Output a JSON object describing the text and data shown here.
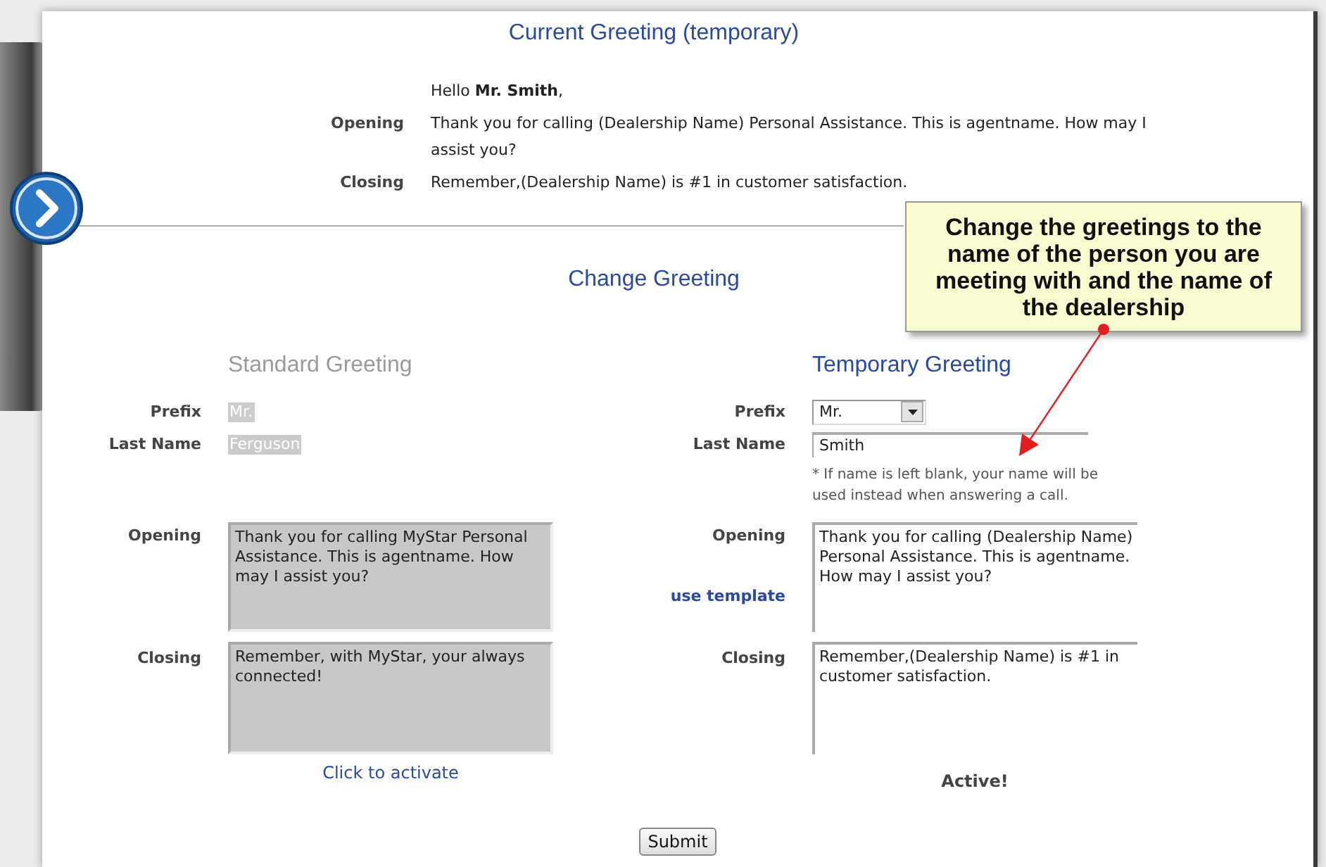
{
  "current_greeting": {
    "title": "Current Greeting (temporary)",
    "salutation": "Hello **Mr. Smith**,",
    "rows": [
      {
        "label": "Opening",
        "text": "Thank you for calling (Dealership Name) Personal Assistance. This is agentname. How may I assist you?"
      },
      {
        "label": "Closing",
        "text": "Remember,(Dealership Name) is #1 in customer satisfaction."
      }
    ]
  },
  "change_greeting": {
    "title": "Change Greeting",
    "columns": [
      {
        "heading": "Standard Greeting",
        "active": false,
        "prefix_label": "Prefix",
        "prefix": "Mr.",
        "last_name_label": "Last Name",
        "last_name": "Ferguson",
        "opening_label": "Opening",
        "opening": "Thank you for calling MyStar Personal Assistance. This is agentname. How may I assist you?",
        "closing_label": "Closing",
        "closing": "Remember, with MyStar, your always connected!",
        "footer": "Click to activate"
      },
      {
        "heading": "Temporary Greeting",
        "active": true,
        "prefix_label": "Prefix",
        "prefix": "Mr.",
        "last_name_label": "Last Name",
        "last_name": "Smith",
        "note": "* If name is left blank, your name will be used instead when answering a call.",
        "opening_label": "Opening",
        "template_link": "use template",
        "opening": "Thank you for calling (Dealership Name) Personal Assistance. This is agentname. How may I assist you?",
        "closing_label": "Closing",
        "closing": "Remember,(Dealership Name) is #1 in customer satisfaction.",
        "footer": "Active!"
      }
    ]
  },
  "submit": "Submit",
  "callout": {
    "text": "Change the greetings to the name of the person you are meeting with and the name of the dealership"
  }
}
